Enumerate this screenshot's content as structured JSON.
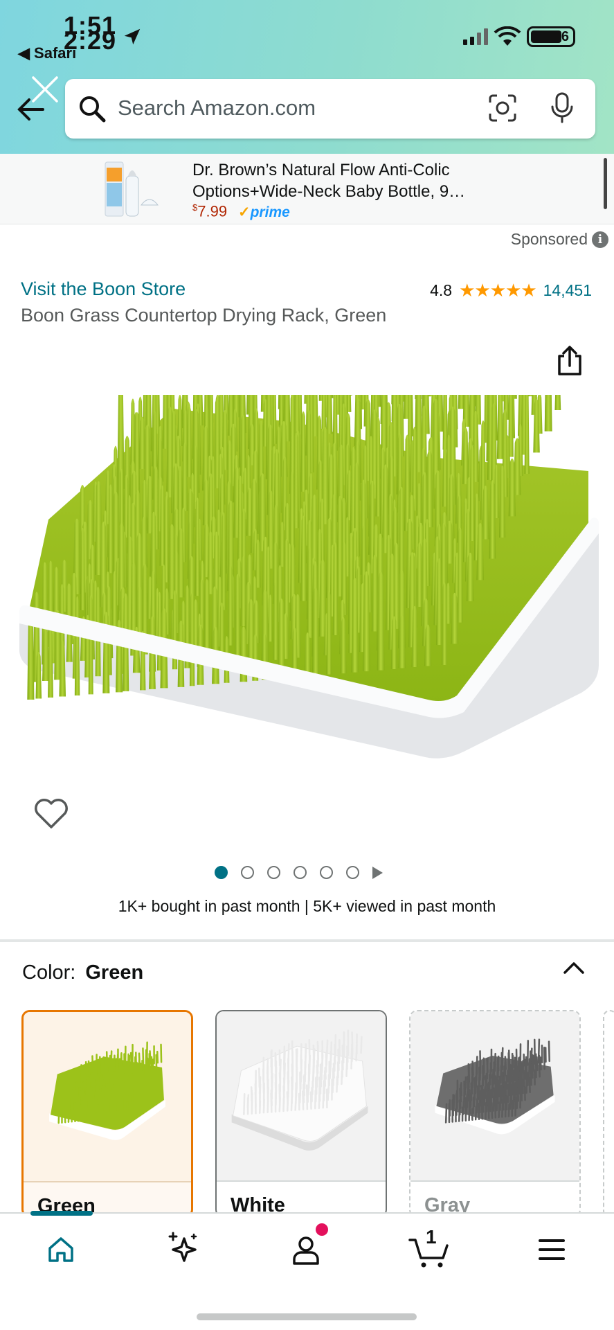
{
  "status_bar": {
    "time_top": "1:51",
    "time_overlay": "2:29",
    "back_app": "◀ Safari",
    "battery": "6"
  },
  "search": {
    "placeholder": "Search Amazon.com"
  },
  "sponsored_banner": {
    "title": "Dr. Brown’s Natural Flow Anti-Colic Options+Wide-Neck Baby Bottle, 9…",
    "price_symbol": "$",
    "price": "7.99",
    "prime_label": "prime"
  },
  "sponsored_label": "Sponsored",
  "product": {
    "store_link": "Visit the Boon Store",
    "rating": "4.8",
    "stars": "★★★★★",
    "review_count": "14,451",
    "title": "Boon Grass Countertop Drying Rack, Green",
    "social_proof": "1K+ bought in past month  |  5K+ viewed in past month",
    "image_count": 6
  },
  "color_selector": {
    "label": "Color:",
    "selected": "Green",
    "options": [
      {
        "name": "Green",
        "color": "#9cc21a"
      },
      {
        "name": "White",
        "color": "#f4f4f4"
      },
      {
        "name": "Gray",
        "color": "#6e6e6e"
      }
    ]
  },
  "nav": {
    "cart_count": "1",
    "accent": "#007185"
  },
  "colors": {
    "link": "#007185",
    "star": "#ff9900",
    "price": "#b12704",
    "notification": "#e3105c"
  }
}
